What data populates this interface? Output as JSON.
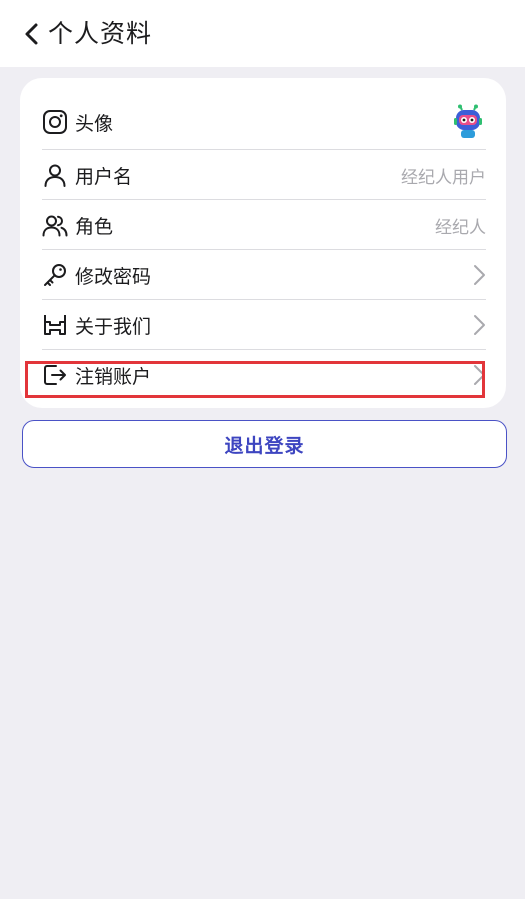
{
  "header": {
    "title": "个人资料"
  },
  "profile": {
    "rows": [
      {
        "label": "头像",
        "icon": "instagram-icon"
      },
      {
        "label": "用户名",
        "value": "经纪人用户",
        "icon": "user-icon"
      },
      {
        "label": "角色",
        "value": "经纪人",
        "icon": "users-icon"
      },
      {
        "label": "修改密码",
        "icon": "key-icon"
      },
      {
        "label": "关于我们",
        "icon": "about-icon"
      },
      {
        "label": "注销账户",
        "icon": "logout-icon"
      }
    ]
  },
  "logout": {
    "label": "退出登录"
  },
  "colors": {
    "accent": "#3d45c0",
    "highlight": "#e2353a",
    "background": "#efeef3"
  }
}
